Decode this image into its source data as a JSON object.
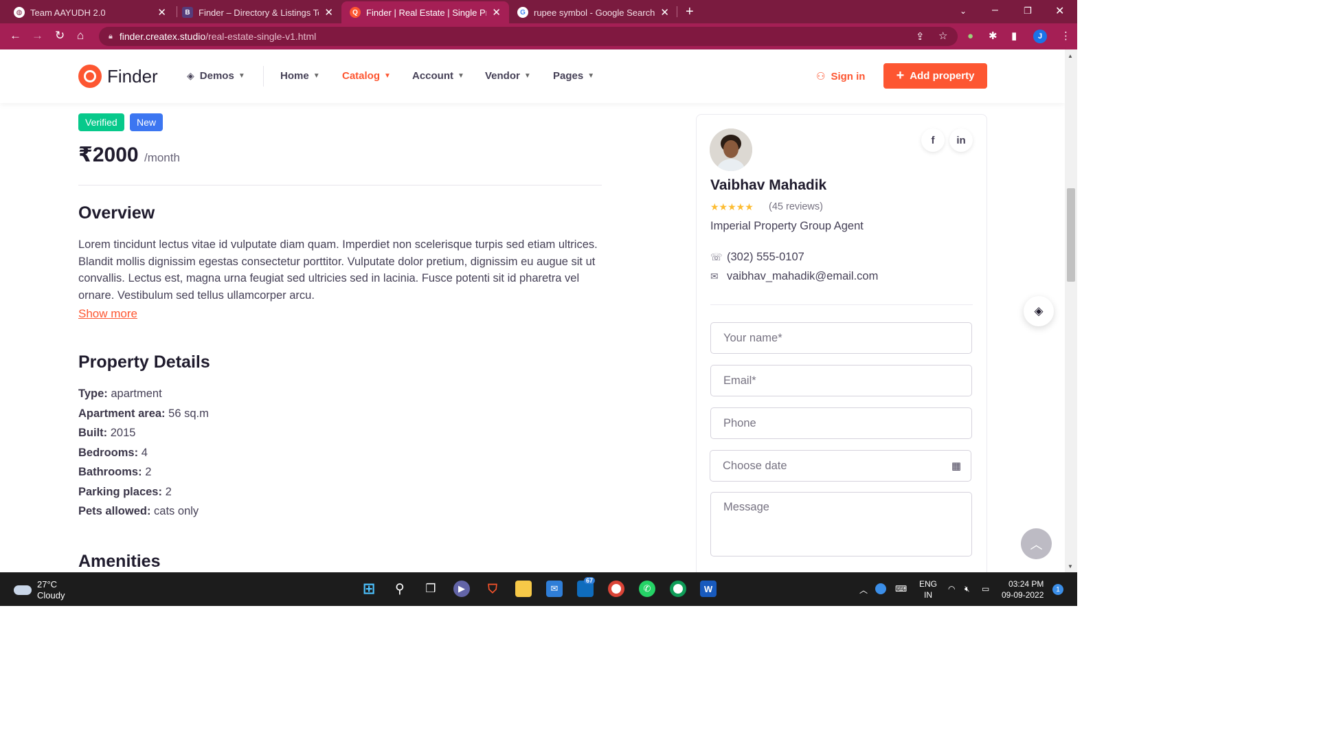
{
  "browser": {
    "tabs": [
      {
        "title": "Team AAYUDH 2.0",
        "fav": "globe-icon",
        "active": false
      },
      {
        "title": "Finder – Directory & Listings Tem",
        "fav": "B",
        "active": false
      },
      {
        "title": "Finder | Real Estate | Single Prope",
        "fav": "finder-icon",
        "active": true
      },
      {
        "title": "rupee symbol - Google Search",
        "fav": "google-icon",
        "active": false
      }
    ],
    "close_glyph": "✕",
    "new_tab_glyph": "+",
    "url_host": "finder.createx.studio",
    "url_path": "/real-estate-single-v1.html",
    "profile_initial": "J"
  },
  "header": {
    "logo_text": "Finder",
    "menu": [
      {
        "label": "Demos"
      },
      {
        "label": "Home"
      },
      {
        "label": "Catalog"
      },
      {
        "label": "Account"
      },
      {
        "label": "Vendor"
      },
      {
        "label": "Pages"
      }
    ],
    "signin_label": "Sign in",
    "add_property_label": "Add property"
  },
  "listing": {
    "badges": [
      {
        "label": "Verified",
        "color": "#07c98b"
      },
      {
        "label": "New",
        "color": "#3c76f1"
      }
    ],
    "price": "₹2000",
    "price_period": "/month",
    "overview_heading": "Overview",
    "overview_text": "Lorem tincidunt lectus vitae id vulputate diam quam. Imperdiet non scelerisque turpis sed etiam ultrices. Blandit mollis dignissim egestas consectetur porttitor. Vulputate dolor pretium, dignissim eu augue sit ut convallis. Lectus est, magna urna feugiat sed ultricies sed in lacinia. Fusce potenti sit id pharetra vel ornare. Vestibulum sed tellus ullamcorper arcu.",
    "show_more": "Show more",
    "details_heading": "Property Details",
    "details": [
      {
        "label": "Type:",
        "value": "apartment"
      },
      {
        "label": "Apartment area:",
        "value": "56 sq.m"
      },
      {
        "label": "Built:",
        "value": "2015"
      },
      {
        "label": "Bedrooms:",
        "value": "4"
      },
      {
        "label": "Bathrooms:",
        "value": "2"
      },
      {
        "label": "Parking places:",
        "value": "2"
      },
      {
        "label": "Pets allowed:",
        "value": "cats only"
      }
    ],
    "amenities_heading": "Amenities"
  },
  "agent": {
    "name": "Vaibhav Mahadik",
    "stars": "★★★★★",
    "rating": 5,
    "reviews": "(45 reviews)",
    "agency": "Imperial Property Group Agent",
    "phone": "(302) 555-0107",
    "email": "vaibhav_mahadik@email.com",
    "social": [
      {
        "name": "facebook-icon",
        "glyph": "f"
      },
      {
        "name": "linkedin-icon",
        "glyph": "in"
      }
    ]
  },
  "form": {
    "name_placeholder": "Your name*",
    "email_placeholder": "Email*",
    "phone_placeholder": "Phone",
    "date_placeholder": "Choose date",
    "message_placeholder": "Message"
  },
  "taskbar": {
    "temp": "27°C",
    "weather": "Cloudy",
    "mail_badge": "67",
    "lang1": "ENG",
    "lang2": "IN",
    "time": "03:24 PM",
    "date": "09-09-2022",
    "notif_count": "1"
  },
  "colors": {
    "accent": "#fd5631",
    "tabbar": "#7a1b3f",
    "addrbar": "#a51f55"
  }
}
